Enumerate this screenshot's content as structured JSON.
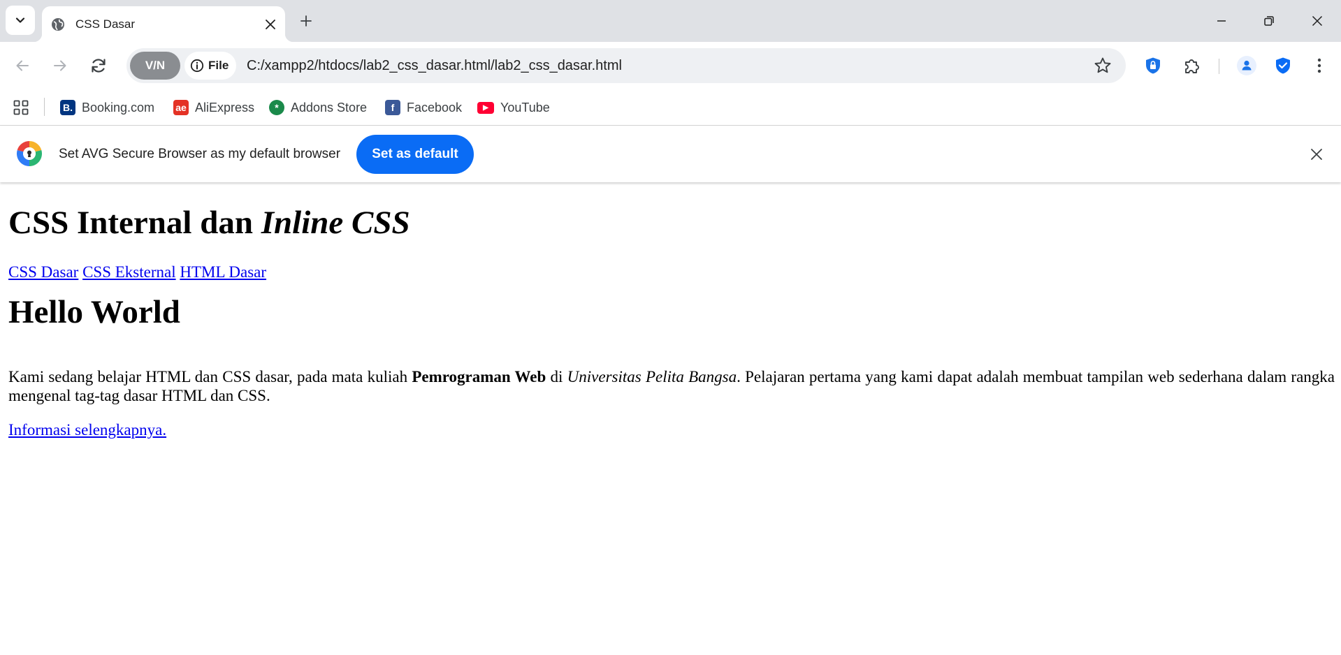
{
  "browser": {
    "tab_title": "CSS Dasar",
    "vpn_label": "V/N",
    "file_chip": "File",
    "url": "C:/xampp2/htdocs/lab2_css_dasar.html/lab2_css_dasar.html"
  },
  "bookmarks": [
    {
      "label": "Booking.com",
      "icon": "B.",
      "color": "#003580"
    },
    {
      "label": "AliExpress",
      "icon": "ae",
      "color": "#e43225"
    },
    {
      "label": "Addons Store",
      "icon": "*",
      "color": "#1a8a4a"
    },
    {
      "label": "Facebook",
      "icon": "f",
      "color": "#3b5998"
    },
    {
      "label": "YouTube",
      "icon": "▶",
      "color": "#ff0033"
    }
  ],
  "infobar": {
    "text": "Set AVG Secure Browser as my default browser",
    "button": "Set as default"
  },
  "page": {
    "h1_plain": "CSS Internal dan ",
    "h1_italic": "Inline CSS",
    "nav_links": [
      "CSS Dasar",
      "CSS Eksternal",
      "HTML Dasar"
    ],
    "h2": "Hello World",
    "para": {
      "before_bold": "Kami sedang belajar HTML dan CSS dasar, pada mata kuliah ",
      "bold": "Pemrograman Web",
      "middle": " di ",
      "italic": "Universitas Pelita Bangsa",
      "after": ". Pelajaran pertama yang kami dapat adalah membuat tampilan web sederhana dalam rangka mengenal tag-tag dasar HTML dan CSS."
    },
    "more_link": "Informasi selengkapnya."
  },
  "colors": {
    "accent": "#0a6cf5",
    "link": "#0000ee",
    "tabstrip": "#dfe1e5"
  }
}
